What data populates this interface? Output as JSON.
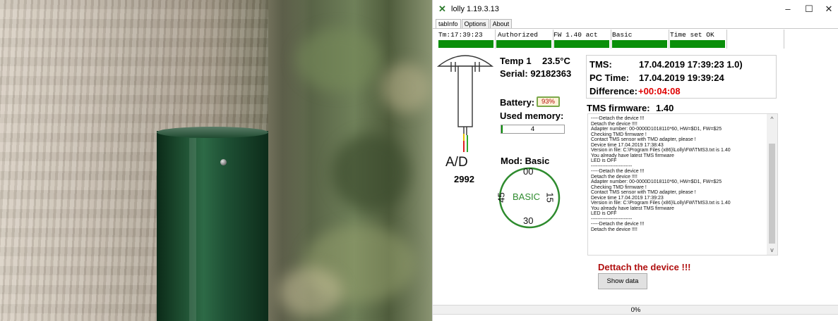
{
  "window": {
    "title": "lolly 1.19.3.13",
    "minimize": "–",
    "maximize": "☐",
    "close": "✕"
  },
  "tabs": [
    "tabInfo",
    "Options",
    "About"
  ],
  "status": {
    "time": "Tm:17:39:23",
    "auth": "Authorized",
    "fw": "FW 1.40 act",
    "mode": "Basic",
    "timeset": "Time set OK"
  },
  "colors": {
    "ok": "#0a8f0a",
    "alert": "#e00000",
    "detach": "#b01010",
    "basic": "#2e8b2e"
  },
  "sensor": {
    "temp_label": "Temp 1",
    "temp_value": "23.5°C",
    "serial": "Serial: 92182363",
    "battery_label": "Battery:",
    "battery_value": "93%",
    "memory_label": "Used memory:",
    "memory_value": "4",
    "memory_fraction": 0.02,
    "ad_label": "A/D",
    "ad_value": "2992"
  },
  "mod": {
    "label": "Mod: Basic",
    "top": "00",
    "right": "15",
    "bottom": "30",
    "left": "45",
    "center": "BASIC"
  },
  "times": {
    "tms_label": "TMS:",
    "tms_value": "17.04.2019 17:39:23 1.0)",
    "pc_label": "PC Time:",
    "pc_value": "17.04.2019 19:39:24",
    "diff_label": "Difference:",
    "diff_value": "+00:04:08"
  },
  "firmware": {
    "label": "TMS firmware:",
    "value": "1.40"
  },
  "log": [
    "-----Detach the device !!!",
    "Detach the device !!!!",
    "Adapter number: 00-0000D1018110*60, HW=$D1, FW=$25",
    "Checking TMD firmware !",
    "Contact TMS sensor with TMD adapter, please !",
    "Device time 17.04.2019 17:38:43",
    "Version in file: C:\\Program Files (x86)\\Lolly\\FW\\TMS3.txt is 1.40",
    "You already have latest TMS firmware",
    "LED is OFF",
    "-------------------------",
    "-----Detach the device !!!",
    "Detach the device !!!!",
    "Adapter number: 00-0000D1018110*60, HW=$D1, FW=$25",
    "Checking TMD firmware !",
    "Contact TMS sensor with TMD adapter, please !",
    "Device time 17.04.2019 17:39:23",
    "Version in file: C:\\Program Files (x86)\\Lolly\\FW\\TMS3.txt is 1.40",
    "You already have latest TMS firmware",
    "LED is OFF",
    "-------------------------",
    "-----Detach the device !!!",
    "Detach the device !!!!"
  ],
  "detach_message": "Dettach the device !!!",
  "show_data_button": "Show data",
  "progress": {
    "text": "0%",
    "value": 0
  },
  "icons": {
    "app": "lolly-app-icon",
    "scroll_up": "scroll-up-icon",
    "scroll_down": "scroll-down-icon",
    "scroll_up_glyph": "^",
    "scroll_down_glyph": "v"
  }
}
